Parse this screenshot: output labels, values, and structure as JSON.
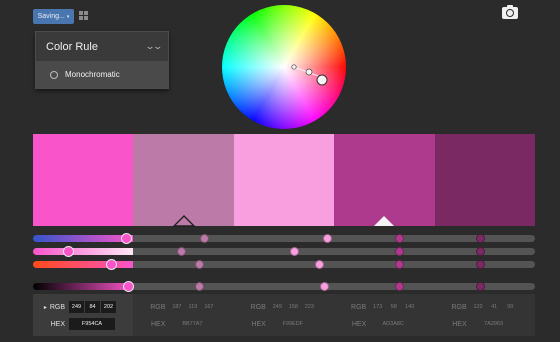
{
  "toolbar": {
    "saving_label": "Saving..."
  },
  "colors": {
    "accent": "#4a76b0",
    "panel": "#3a3a3a"
  },
  "rule_panel": {
    "title": "Color Rule",
    "option": "Monochromatic"
  },
  "swatches": [
    {
      "hex": "#F954CA",
      "color": "#f954ca",
      "marker": "none"
    },
    {
      "hex": "#BB7AA7",
      "color": "#bb7aa7",
      "marker": "outline"
    },
    {
      "hex": "#F99EDF",
      "color": "#f99edf",
      "marker": "none"
    },
    {
      "hex": "#AD3A8C",
      "color": "#ad3a8c",
      "marker": "filled"
    },
    {
      "hex": "#7A2963",
      "color": "#7a2963",
      "marker": "none"
    }
  ],
  "sliders": [
    {
      "gradient": "linear-gradient(to right, #3355cc, #f954ca)",
      "knobs": [
        0.185,
        0.34,
        0.585,
        0.73,
        0.89
      ]
    },
    {
      "gradient": "linear-gradient(to right, #f954ca, #ffe8f6)",
      "knobs": [
        0.07,
        0.295,
        0.52,
        0.73,
        0.89
      ]
    },
    {
      "gradient": "linear-gradient(to right, #ff4a1a, #f954ca)",
      "knobs": [
        0.155,
        0.33,
        0.57,
        0.73,
        0.89
      ]
    },
    {
      "gradient": "linear-gradient(to right, #000000, #f954ca)",
      "knobs": [
        0.19,
        0.33,
        0.58,
        0.73,
        0.89
      ]
    }
  ],
  "values": [
    {
      "r": "249",
      "g": "84",
      "b": "202",
      "hex": "F954CA"
    },
    {
      "r": "187",
      "g": "119",
      "b": "167",
      "hex": "BB77A7"
    },
    {
      "r": "249",
      "g": "158",
      "b": "223",
      "hex": "F99EDF"
    },
    {
      "r": "173",
      "g": "58",
      "b": "140",
      "hex": "AD3A8C"
    },
    {
      "r": "122",
      "g": "41",
      "b": "99",
      "hex": "7A2963"
    }
  ],
  "labels": {
    "rgb": "RGB",
    "hex": "HEX"
  }
}
